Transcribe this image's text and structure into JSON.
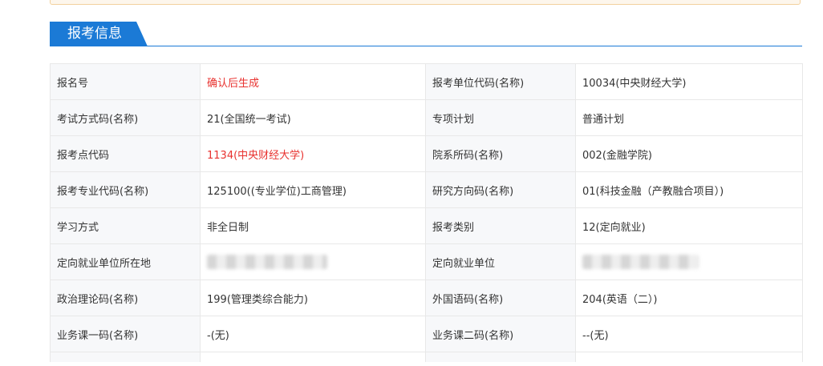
{
  "section": {
    "title": "报考信息"
  },
  "rows": [
    {
      "l1": "报名号",
      "v1": "确认后生成",
      "l2": "报考单位代码(名称)",
      "v2": "10034(中央财经大学)"
    },
    {
      "l1": "考试方式码(名称)",
      "v1": "21(全国统一考试)",
      "l2": "专项计划",
      "v2": "普通计划"
    },
    {
      "l1": "报考点代码",
      "v1": "1134(中央财经大学)",
      "l2": "院系所码(名称)",
      "v2": "002(金融学院)"
    },
    {
      "l1": "报考专业代码(名称)",
      "v1": "125100((专业学位)工商管理)",
      "l2": "研究方向码(名称)",
      "v2": "01(科技金融（产教融合项目）)"
    },
    {
      "l1": "学习方式",
      "v1": "非全日制",
      "l2": "报考类别",
      "v2": "12(定向就业)"
    },
    {
      "l1": "定向就业单位所在地",
      "v1": "",
      "l2": "定向就业单位",
      "v2": ""
    },
    {
      "l1": "政治理论码(名称)",
      "v1": "199(管理类综合能力)",
      "l2": "外国语码(名称)",
      "v2": "204(英语（二）)"
    },
    {
      "l1": "业务课一码(名称)",
      "v1": "-(无)",
      "l2": "业务课二码(名称)",
      "v2": "--(无)"
    }
  ],
  "colors": {
    "accent": "#1b7ad6",
    "highlight_red": "#e8322f",
    "label_bg": "#f7f8fa"
  }
}
